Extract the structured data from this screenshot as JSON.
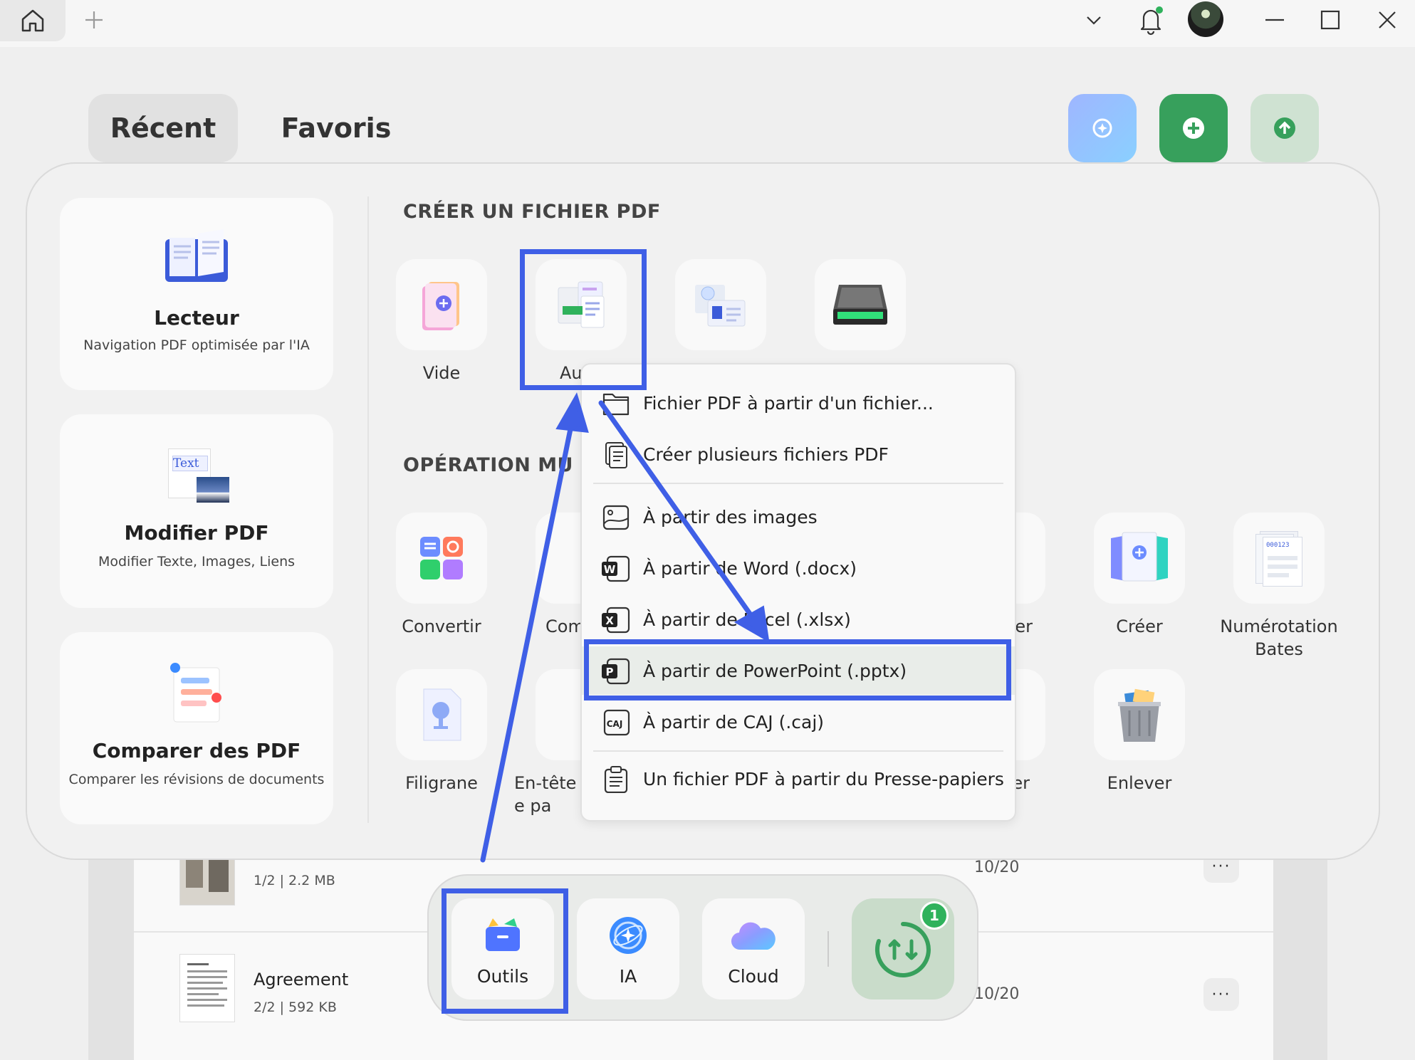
{
  "tabs": {
    "recent": "Récent",
    "favorites": "Favoris"
  },
  "feature_cards": [
    {
      "title": "Lecteur",
      "subtitle": "Navigation PDF optimisée par l'IA"
    },
    {
      "title": "Modifier PDF",
      "subtitle": "Modifier Texte, Images, Liens",
      "thumb_text": "Text"
    },
    {
      "title": "Comparer des PDF",
      "subtitle": "Comparer les révisions de documents"
    }
  ],
  "create_section": {
    "title": "CRÉER UN FICHIER PDF",
    "tiles": [
      {
        "label": "Vide"
      },
      {
        "label": "Au"
      }
    ]
  },
  "batch_section": {
    "title": "OPÉRATION MU",
    "tiles": [
      {
        "label": "Convertir"
      },
      {
        "label": "Com"
      },
      {
        "label": "er"
      },
      {
        "label": "Créer"
      },
      {
        "label": "Numérotation Bates"
      },
      {
        "label": "Filigrane"
      },
      {
        "label": "En-tête e pa"
      },
      {
        "label": "er"
      },
      {
        "label": "Enlever"
      }
    ],
    "bates_sample": "000123"
  },
  "create_menu": {
    "items": [
      {
        "label": "Fichier PDF à partir d'un fichier...",
        "icon": "folder-icon"
      },
      {
        "label": "Créer plusieurs fichiers PDF",
        "icon": "multi-file-icon"
      },
      {
        "label": "À partir des images",
        "icon": "image-icon"
      },
      {
        "label": "À partir de Word (.docx)",
        "icon": "word-icon"
      },
      {
        "label": "À partir de Excel (.xlsx)",
        "icon": "excel-icon"
      },
      {
        "label": "À partir de PowerPoint (.pptx)",
        "icon": "powerpoint-icon"
      },
      {
        "label": "À partir de CAJ (.caj)",
        "icon": "caj-icon"
      },
      {
        "label": "Un fichier PDF à partir du Presse-papiers",
        "icon": "clipboard-icon"
      }
    ],
    "icon_letters": {
      "word": "W",
      "excel": "X",
      "powerpoint": "P",
      "caj": "CAJ"
    },
    "selected": "À partir de PowerPoint (.pptx)"
  },
  "files": [
    {
      "meta": "1/2 | 2.2 MB",
      "date": "10/20"
    },
    {
      "name": "Agreement",
      "meta": "2/2 | 592 KB",
      "date": "10/20"
    }
  ],
  "dock": {
    "tools": "Outils",
    "ai": "IA",
    "cloud": "Cloud",
    "sync_badge": "1"
  },
  "colors": {
    "accent_blue": "#3f5fe6",
    "green": "#37a05c",
    "ai_gradient": [
      "#9fb6ff",
      "#8ad0ff"
    ]
  },
  "more_label": "···"
}
